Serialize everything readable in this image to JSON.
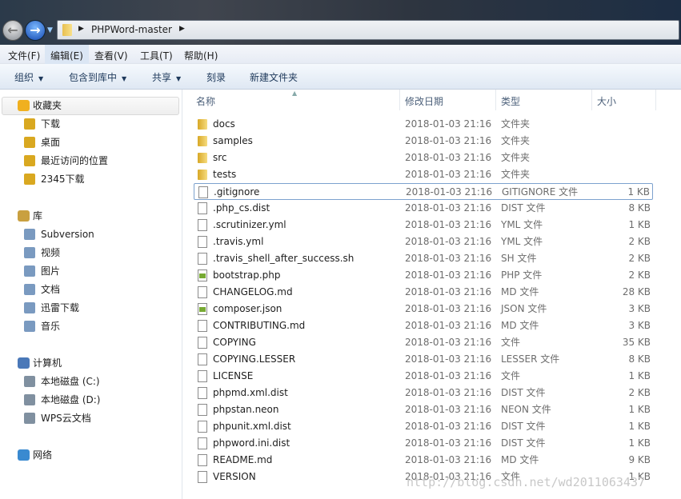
{
  "address": {
    "crumb": "PHPWord-master"
  },
  "menu": [
    "文件(F)",
    "编辑(E)",
    "查看(V)",
    "工具(T)",
    "帮助(H)"
  ],
  "toolbar": {
    "organize": "组织",
    "include": "包含到库中",
    "share": "共享",
    "burn": "刻录",
    "new_folder": "新建文件夹"
  },
  "sidebar": {
    "favorites": {
      "label": "收藏夹",
      "items": [
        "下载",
        "桌面",
        "最近访问的位置",
        "2345下载"
      ]
    },
    "libraries": {
      "label": "库",
      "items": [
        "Subversion",
        "视频",
        "图片",
        "文档",
        "迅雷下载",
        "音乐"
      ]
    },
    "computer": {
      "label": "计算机",
      "items": [
        "本地磁盘 (C:)",
        "本地磁盘 (D:)",
        "WPS云文档"
      ]
    },
    "network": {
      "label": "网络"
    }
  },
  "columns": {
    "name": "名称",
    "date": "修改日期",
    "type": "类型",
    "size": "大小"
  },
  "files": [
    {
      "name": "docs",
      "date": "2018-01-03 21:16",
      "type": "文件夹",
      "size": "",
      "icon": "folder"
    },
    {
      "name": "samples",
      "date": "2018-01-03 21:16",
      "type": "文件夹",
      "size": "",
      "icon": "folder"
    },
    {
      "name": "src",
      "date": "2018-01-03 21:16",
      "type": "文件夹",
      "size": "",
      "icon": "folder"
    },
    {
      "name": "tests",
      "date": "2018-01-03 21:16",
      "type": "文件夹",
      "size": "",
      "icon": "folder"
    },
    {
      "name": ".gitignore",
      "date": "2018-01-03 21:16",
      "type": "GITIGNORE 文件",
      "size": "1 KB",
      "icon": "doc"
    },
    {
      "name": ".php_cs.dist",
      "date": "2018-01-03 21:16",
      "type": "DIST 文件",
      "size": "8 KB",
      "icon": "doc"
    },
    {
      "name": ".scrutinizer.yml",
      "date": "2018-01-03 21:16",
      "type": "YML 文件",
      "size": "1 KB",
      "icon": "doc"
    },
    {
      "name": ".travis.yml",
      "date": "2018-01-03 21:16",
      "type": "YML 文件",
      "size": "2 KB",
      "icon": "doc"
    },
    {
      "name": ".travis_shell_after_success.sh",
      "date": "2018-01-03 21:16",
      "type": "SH 文件",
      "size": "2 KB",
      "icon": "doc"
    },
    {
      "name": "bootstrap.php",
      "date": "2018-01-03 21:16",
      "type": "PHP 文件",
      "size": "2 KB",
      "icon": "php"
    },
    {
      "name": "CHANGELOG.md",
      "date": "2018-01-03 21:16",
      "type": "MD 文件",
      "size": "28 KB",
      "icon": "doc"
    },
    {
      "name": "composer.json",
      "date": "2018-01-03 21:16",
      "type": "JSON 文件",
      "size": "3 KB",
      "icon": "php"
    },
    {
      "name": "CONTRIBUTING.md",
      "date": "2018-01-03 21:16",
      "type": "MD 文件",
      "size": "3 KB",
      "icon": "doc"
    },
    {
      "name": "COPYING",
      "date": "2018-01-03 21:16",
      "type": "文件",
      "size": "35 KB",
      "icon": "doc"
    },
    {
      "name": "COPYING.LESSER",
      "date": "2018-01-03 21:16",
      "type": "LESSER 文件",
      "size": "8 KB",
      "icon": "doc"
    },
    {
      "name": "LICENSE",
      "date": "2018-01-03 21:16",
      "type": "文件",
      "size": "1 KB",
      "icon": "doc"
    },
    {
      "name": "phpmd.xml.dist",
      "date": "2018-01-03 21:16",
      "type": "DIST 文件",
      "size": "2 KB",
      "icon": "doc"
    },
    {
      "name": "phpstan.neon",
      "date": "2018-01-03 21:16",
      "type": "NEON 文件",
      "size": "1 KB",
      "icon": "doc"
    },
    {
      "name": "phpunit.xml.dist",
      "date": "2018-01-03 21:16",
      "type": "DIST 文件",
      "size": "1 KB",
      "icon": "doc"
    },
    {
      "name": "phpword.ini.dist",
      "date": "2018-01-03 21:16",
      "type": "DIST 文件",
      "size": "1 KB",
      "icon": "doc"
    },
    {
      "name": "README.md",
      "date": "2018-01-03 21:16",
      "type": "MD 文件",
      "size": "9 KB",
      "icon": "doc"
    },
    {
      "name": "VERSION",
      "date": "2018-01-03 21:16",
      "type": "文件",
      "size": "1 KB",
      "icon": "doc"
    }
  ],
  "focused_file": ".gitignore",
  "watermark": "http://blog.csdn.net/wd2011063437"
}
